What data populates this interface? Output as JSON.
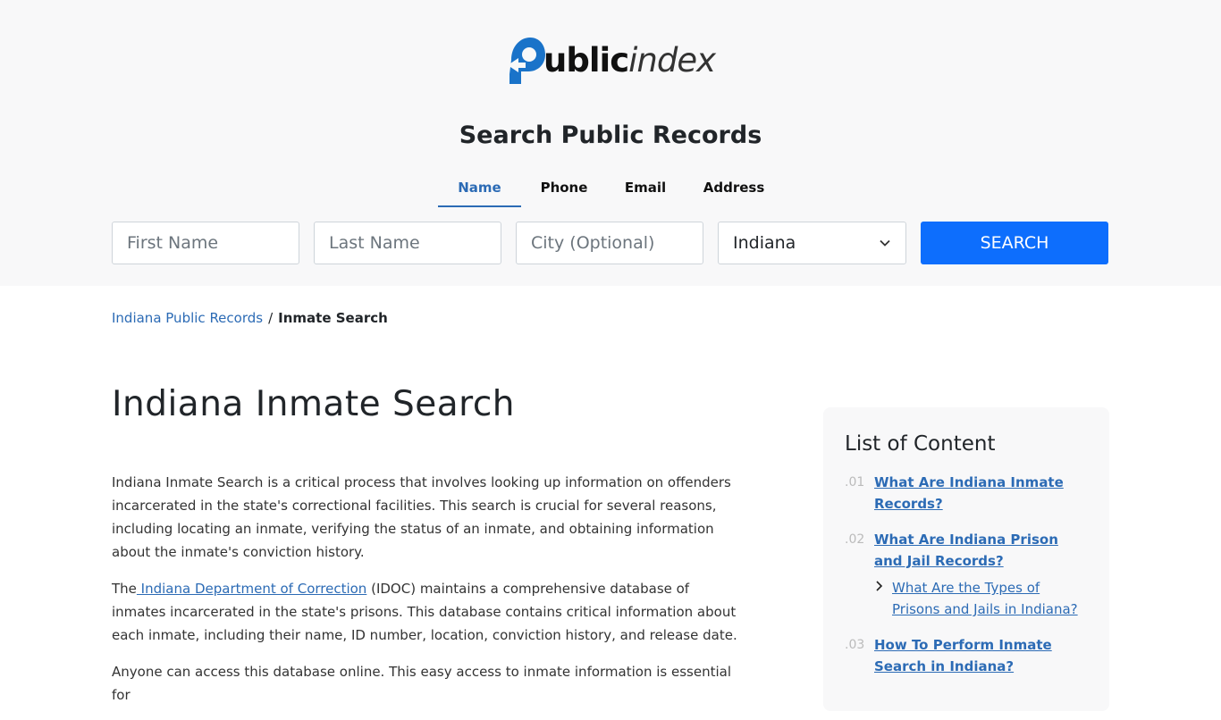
{
  "header": {
    "logo_bold": "ublic",
    "logo_light": "index",
    "title": "Search Public Records",
    "tabs": [
      {
        "label": "Name",
        "active": true
      },
      {
        "label": "Phone",
        "active": false
      },
      {
        "label": "Email",
        "active": false
      },
      {
        "label": "Address",
        "active": false
      }
    ]
  },
  "search_form": {
    "first_name_placeholder": "First Name",
    "last_name_placeholder": "Last Name",
    "city_placeholder": "City (Optional)",
    "state_value": "Indiana",
    "button_label": "SEARCH"
  },
  "breadcrumb": {
    "parent": "Indiana Public Records",
    "separator": "/",
    "current": "Inmate Search"
  },
  "main": {
    "title": "Indiana Inmate Search",
    "para1": "Indiana Inmate Search is a critical process that involves looking up information on offenders incarcerated in the state's correctional facilities. This search is crucial for several reasons, including locating an inmate, verifying the status of an inmate, and obtaining information about the inmate's conviction history.",
    "para2_prefix": "The",
    "para2_link": " Indiana Department of Correction",
    "para2_suffix": " (IDOC) maintains a comprehensive database of inmates incarcerated in the state's prisons. This database contains critical information about each inmate, including their name, ID number, location, conviction history, and release date.",
    "para3": "Anyone can access this database online. This easy access to inmate information is essential for"
  },
  "toc": {
    "title": "List of Content",
    "items": [
      {
        "num": ".01",
        "label": "What Are Indiana Inmate Records? "
      },
      {
        "num": ".02",
        "label": "What Are Indiana Prison and Jail Records?"
      },
      {
        "num": ".03",
        "label": "How To Perform Inmate Search in Indiana?"
      }
    ],
    "sub_item": "What Are the Types of Prisons and Jails in Indiana?"
  },
  "colors": {
    "accent": "#2c6bb5",
    "button": "#0d6efd",
    "hero_bg": "#f8f8f9"
  }
}
